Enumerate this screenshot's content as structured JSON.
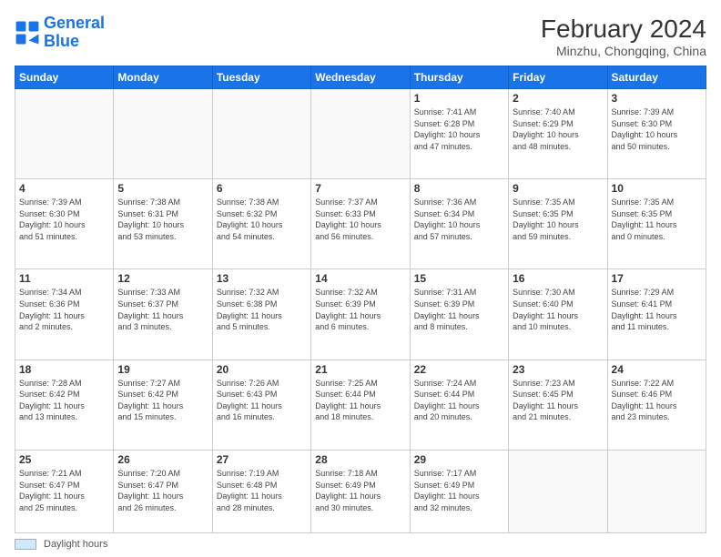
{
  "logo": {
    "line1": "General",
    "line2": "Blue"
  },
  "title": "February 2024",
  "subtitle": "Minzhu, Chongqing, China",
  "days_of_week": [
    "Sunday",
    "Monday",
    "Tuesday",
    "Wednesday",
    "Thursday",
    "Friday",
    "Saturday"
  ],
  "footer_label": "Daylight hours",
  "weeks": [
    [
      {
        "day": "",
        "info": ""
      },
      {
        "day": "",
        "info": ""
      },
      {
        "day": "",
        "info": ""
      },
      {
        "day": "",
        "info": ""
      },
      {
        "day": "1",
        "info": "Sunrise: 7:41 AM\nSunset: 6:28 PM\nDaylight: 10 hours\nand 47 minutes."
      },
      {
        "day": "2",
        "info": "Sunrise: 7:40 AM\nSunset: 6:29 PM\nDaylight: 10 hours\nand 48 minutes."
      },
      {
        "day": "3",
        "info": "Sunrise: 7:39 AM\nSunset: 6:30 PM\nDaylight: 10 hours\nand 50 minutes."
      }
    ],
    [
      {
        "day": "4",
        "info": "Sunrise: 7:39 AM\nSunset: 6:30 PM\nDaylight: 10 hours\nand 51 minutes."
      },
      {
        "day": "5",
        "info": "Sunrise: 7:38 AM\nSunset: 6:31 PM\nDaylight: 10 hours\nand 53 minutes."
      },
      {
        "day": "6",
        "info": "Sunrise: 7:38 AM\nSunset: 6:32 PM\nDaylight: 10 hours\nand 54 minutes."
      },
      {
        "day": "7",
        "info": "Sunrise: 7:37 AM\nSunset: 6:33 PM\nDaylight: 10 hours\nand 56 minutes."
      },
      {
        "day": "8",
        "info": "Sunrise: 7:36 AM\nSunset: 6:34 PM\nDaylight: 10 hours\nand 57 minutes."
      },
      {
        "day": "9",
        "info": "Sunrise: 7:35 AM\nSunset: 6:35 PM\nDaylight: 10 hours\nand 59 minutes."
      },
      {
        "day": "10",
        "info": "Sunrise: 7:35 AM\nSunset: 6:35 PM\nDaylight: 11 hours\nand 0 minutes."
      }
    ],
    [
      {
        "day": "11",
        "info": "Sunrise: 7:34 AM\nSunset: 6:36 PM\nDaylight: 11 hours\nand 2 minutes."
      },
      {
        "day": "12",
        "info": "Sunrise: 7:33 AM\nSunset: 6:37 PM\nDaylight: 11 hours\nand 3 minutes."
      },
      {
        "day": "13",
        "info": "Sunrise: 7:32 AM\nSunset: 6:38 PM\nDaylight: 11 hours\nand 5 minutes."
      },
      {
        "day": "14",
        "info": "Sunrise: 7:32 AM\nSunset: 6:39 PM\nDaylight: 11 hours\nand 6 minutes."
      },
      {
        "day": "15",
        "info": "Sunrise: 7:31 AM\nSunset: 6:39 PM\nDaylight: 11 hours\nand 8 minutes."
      },
      {
        "day": "16",
        "info": "Sunrise: 7:30 AM\nSunset: 6:40 PM\nDaylight: 11 hours\nand 10 minutes."
      },
      {
        "day": "17",
        "info": "Sunrise: 7:29 AM\nSunset: 6:41 PM\nDaylight: 11 hours\nand 11 minutes."
      }
    ],
    [
      {
        "day": "18",
        "info": "Sunrise: 7:28 AM\nSunset: 6:42 PM\nDaylight: 11 hours\nand 13 minutes."
      },
      {
        "day": "19",
        "info": "Sunrise: 7:27 AM\nSunset: 6:42 PM\nDaylight: 11 hours\nand 15 minutes."
      },
      {
        "day": "20",
        "info": "Sunrise: 7:26 AM\nSunset: 6:43 PM\nDaylight: 11 hours\nand 16 minutes."
      },
      {
        "day": "21",
        "info": "Sunrise: 7:25 AM\nSunset: 6:44 PM\nDaylight: 11 hours\nand 18 minutes."
      },
      {
        "day": "22",
        "info": "Sunrise: 7:24 AM\nSunset: 6:44 PM\nDaylight: 11 hours\nand 20 minutes."
      },
      {
        "day": "23",
        "info": "Sunrise: 7:23 AM\nSunset: 6:45 PM\nDaylight: 11 hours\nand 21 minutes."
      },
      {
        "day": "24",
        "info": "Sunrise: 7:22 AM\nSunset: 6:46 PM\nDaylight: 11 hours\nand 23 minutes."
      }
    ],
    [
      {
        "day": "25",
        "info": "Sunrise: 7:21 AM\nSunset: 6:47 PM\nDaylight: 11 hours\nand 25 minutes."
      },
      {
        "day": "26",
        "info": "Sunrise: 7:20 AM\nSunset: 6:47 PM\nDaylight: 11 hours\nand 26 minutes."
      },
      {
        "day": "27",
        "info": "Sunrise: 7:19 AM\nSunset: 6:48 PM\nDaylight: 11 hours\nand 28 minutes."
      },
      {
        "day": "28",
        "info": "Sunrise: 7:18 AM\nSunset: 6:49 PM\nDaylight: 11 hours\nand 30 minutes."
      },
      {
        "day": "29",
        "info": "Sunrise: 7:17 AM\nSunset: 6:49 PM\nDaylight: 11 hours\nand 32 minutes."
      },
      {
        "day": "",
        "info": ""
      },
      {
        "day": "",
        "info": ""
      }
    ]
  ]
}
